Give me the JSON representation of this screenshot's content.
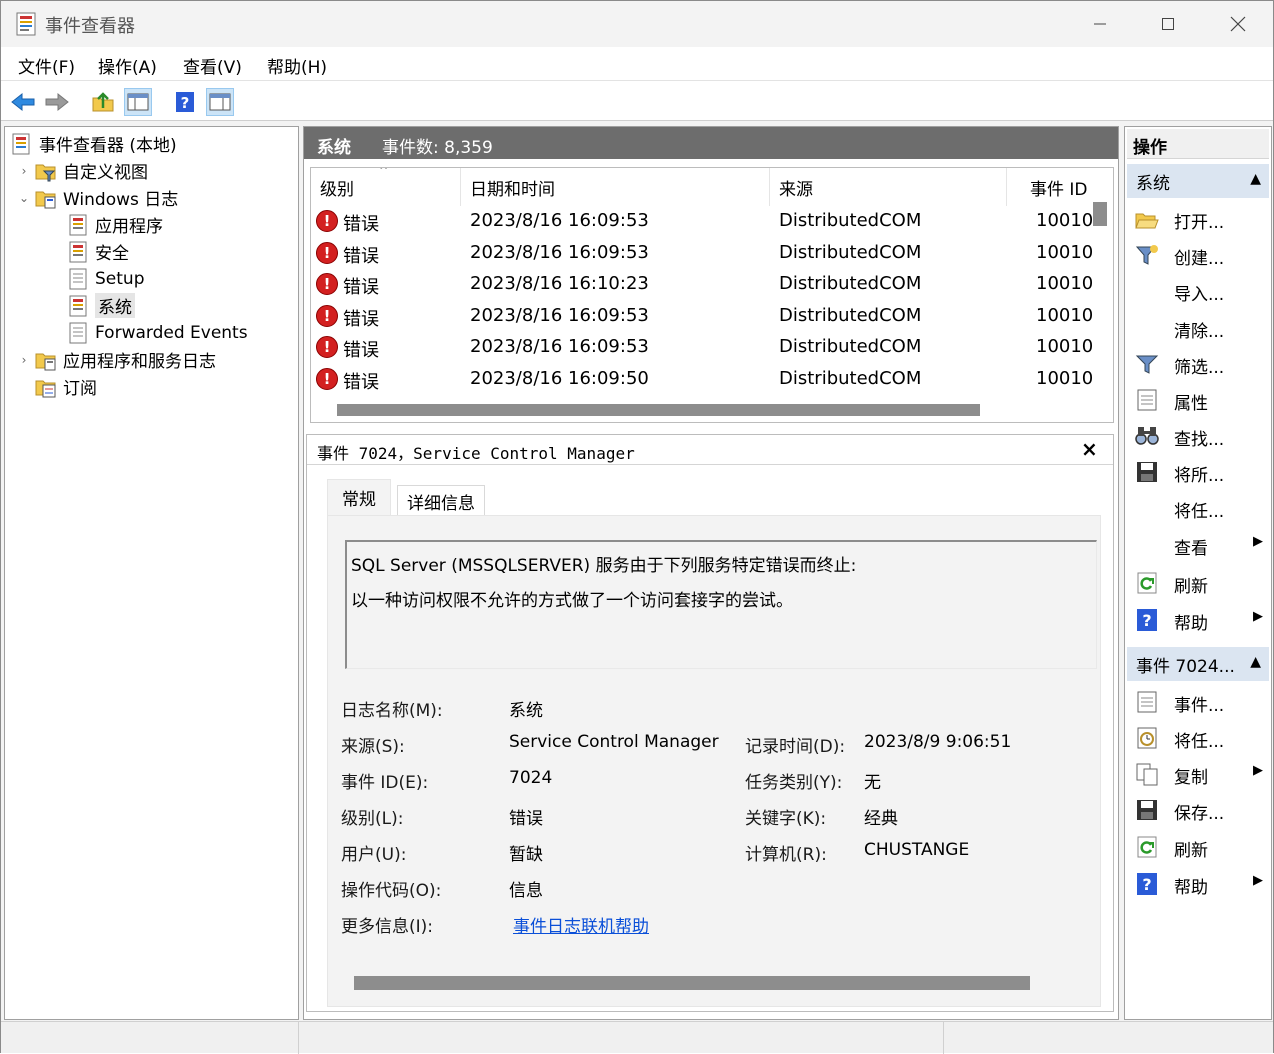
{
  "window": {
    "title": "事件查看器"
  },
  "menu": [
    "文件(F)",
    "操作(A)",
    "查看(V)",
    "帮助(H)"
  ],
  "tree": {
    "root": "事件查看器 (本地)",
    "custom_views": "自定义视图",
    "windows_logs": "Windows 日志",
    "logs": [
      "应用程序",
      "安全",
      "Setup",
      "系统",
      "Forwarded Events"
    ],
    "app_service_logs": "应用程序和服务日志",
    "subscriptions": "订阅"
  },
  "list": {
    "header_name": "系统",
    "header_count": "事件数: 8,359",
    "columns": [
      "级别",
      "日期和时间",
      "来源",
      "事件 ID"
    ],
    "rows": [
      {
        "level": "错误",
        "datetime": "2023/8/16 16:09:53",
        "source": "DistributedCOM",
        "id": "10010"
      },
      {
        "level": "错误",
        "datetime": "2023/8/16 16:09:53",
        "source": "DistributedCOM",
        "id": "10010"
      },
      {
        "level": "错误",
        "datetime": "2023/8/16 16:10:23",
        "source": "DistributedCOM",
        "id": "10010"
      },
      {
        "level": "错误",
        "datetime": "2023/8/16 16:09:53",
        "source": "DistributedCOM",
        "id": "10010"
      },
      {
        "level": "错误",
        "datetime": "2023/8/16 16:09:53",
        "source": "DistributedCOM",
        "id": "10010"
      },
      {
        "level": "错误",
        "datetime": "2023/8/16 16:09:50",
        "source": "DistributedCOM",
        "id": "10010"
      }
    ]
  },
  "detail": {
    "title": "事件 7024，Service Control Manager",
    "close": "×",
    "tabs": [
      "常规",
      "详细信息"
    ],
    "message_line1": "SQL Server (MSSQLSERVER) 服务由于下列服务特定错误而终止:",
    "message_line2": "以一种访问权限不允许的方式做了一个访问套接字的尝试。",
    "fields": {
      "log_name_label": "日志名称(M):",
      "log_name": "系统",
      "source_label": "来源(S):",
      "source": "Service Control Manager",
      "logged_label": "记录时间(D):",
      "logged": "2023/8/9 9:06:51",
      "event_id_label": "事件 ID(E):",
      "event_id": "7024",
      "task_label": "任务类别(Y):",
      "task": "无",
      "level_label": "级别(L):",
      "level": "错误",
      "keywords_label": "关键字(K):",
      "keywords": "经典",
      "user_label": "用户(U):",
      "user": "暂缺",
      "computer_label": "计算机(R):",
      "computer": "CHUSTANGE",
      "opcode_label": "操作代码(O):",
      "opcode": "信息",
      "more_info_label": "更多信息(I):",
      "more_info_link": "事件日志联机帮助"
    }
  },
  "actions": {
    "title": "操作",
    "section1": "系统",
    "items1": [
      "打开...",
      "创建...",
      "导入...",
      "清除...",
      "筛选...",
      "属性",
      "查找...",
      "将所...",
      "将任...",
      "查看",
      "刷新",
      "帮助"
    ],
    "section2": "事件 7024...",
    "items2": [
      "事件...",
      "将任...",
      "复制",
      "保存...",
      "刷新",
      "帮助"
    ]
  }
}
